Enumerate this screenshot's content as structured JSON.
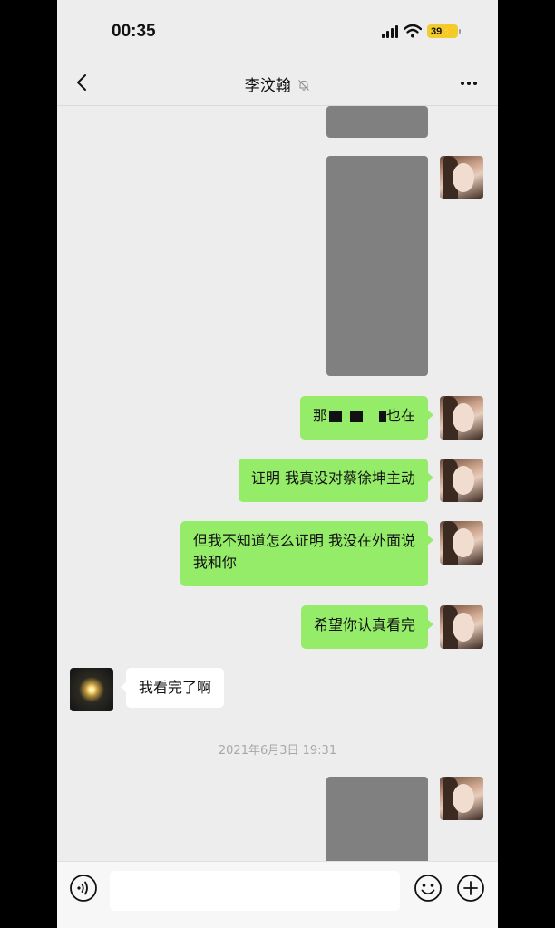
{
  "status_bar": {
    "time": "00:35",
    "battery": "39"
  },
  "header": {
    "title": "李汶翰"
  },
  "messages": {
    "m1_prefix": "那",
    "m1_suffix": "也在",
    "m2": "证明 我真没对蔡徐坤主动",
    "m3_line1": "但我不知道怎么证明 我没在外面说",
    "m3_line2": "我和你",
    "m4": "希望你认真看完",
    "m5": "我看完了啊"
  },
  "timestamp": "2021年6月3日 19:31",
  "input": {
    "value": "",
    "placeholder": ""
  },
  "icons": {
    "back": "chevron-left-icon",
    "mute": "bell-off-icon",
    "more": "more-dots-icon",
    "voice": "voice-icon",
    "emoji": "emoji-icon",
    "plus": "plus-icon"
  },
  "colors": {
    "outgoing_bubble": "#95ec69",
    "incoming_bubble": "#ffffff",
    "background": "#ededed"
  }
}
